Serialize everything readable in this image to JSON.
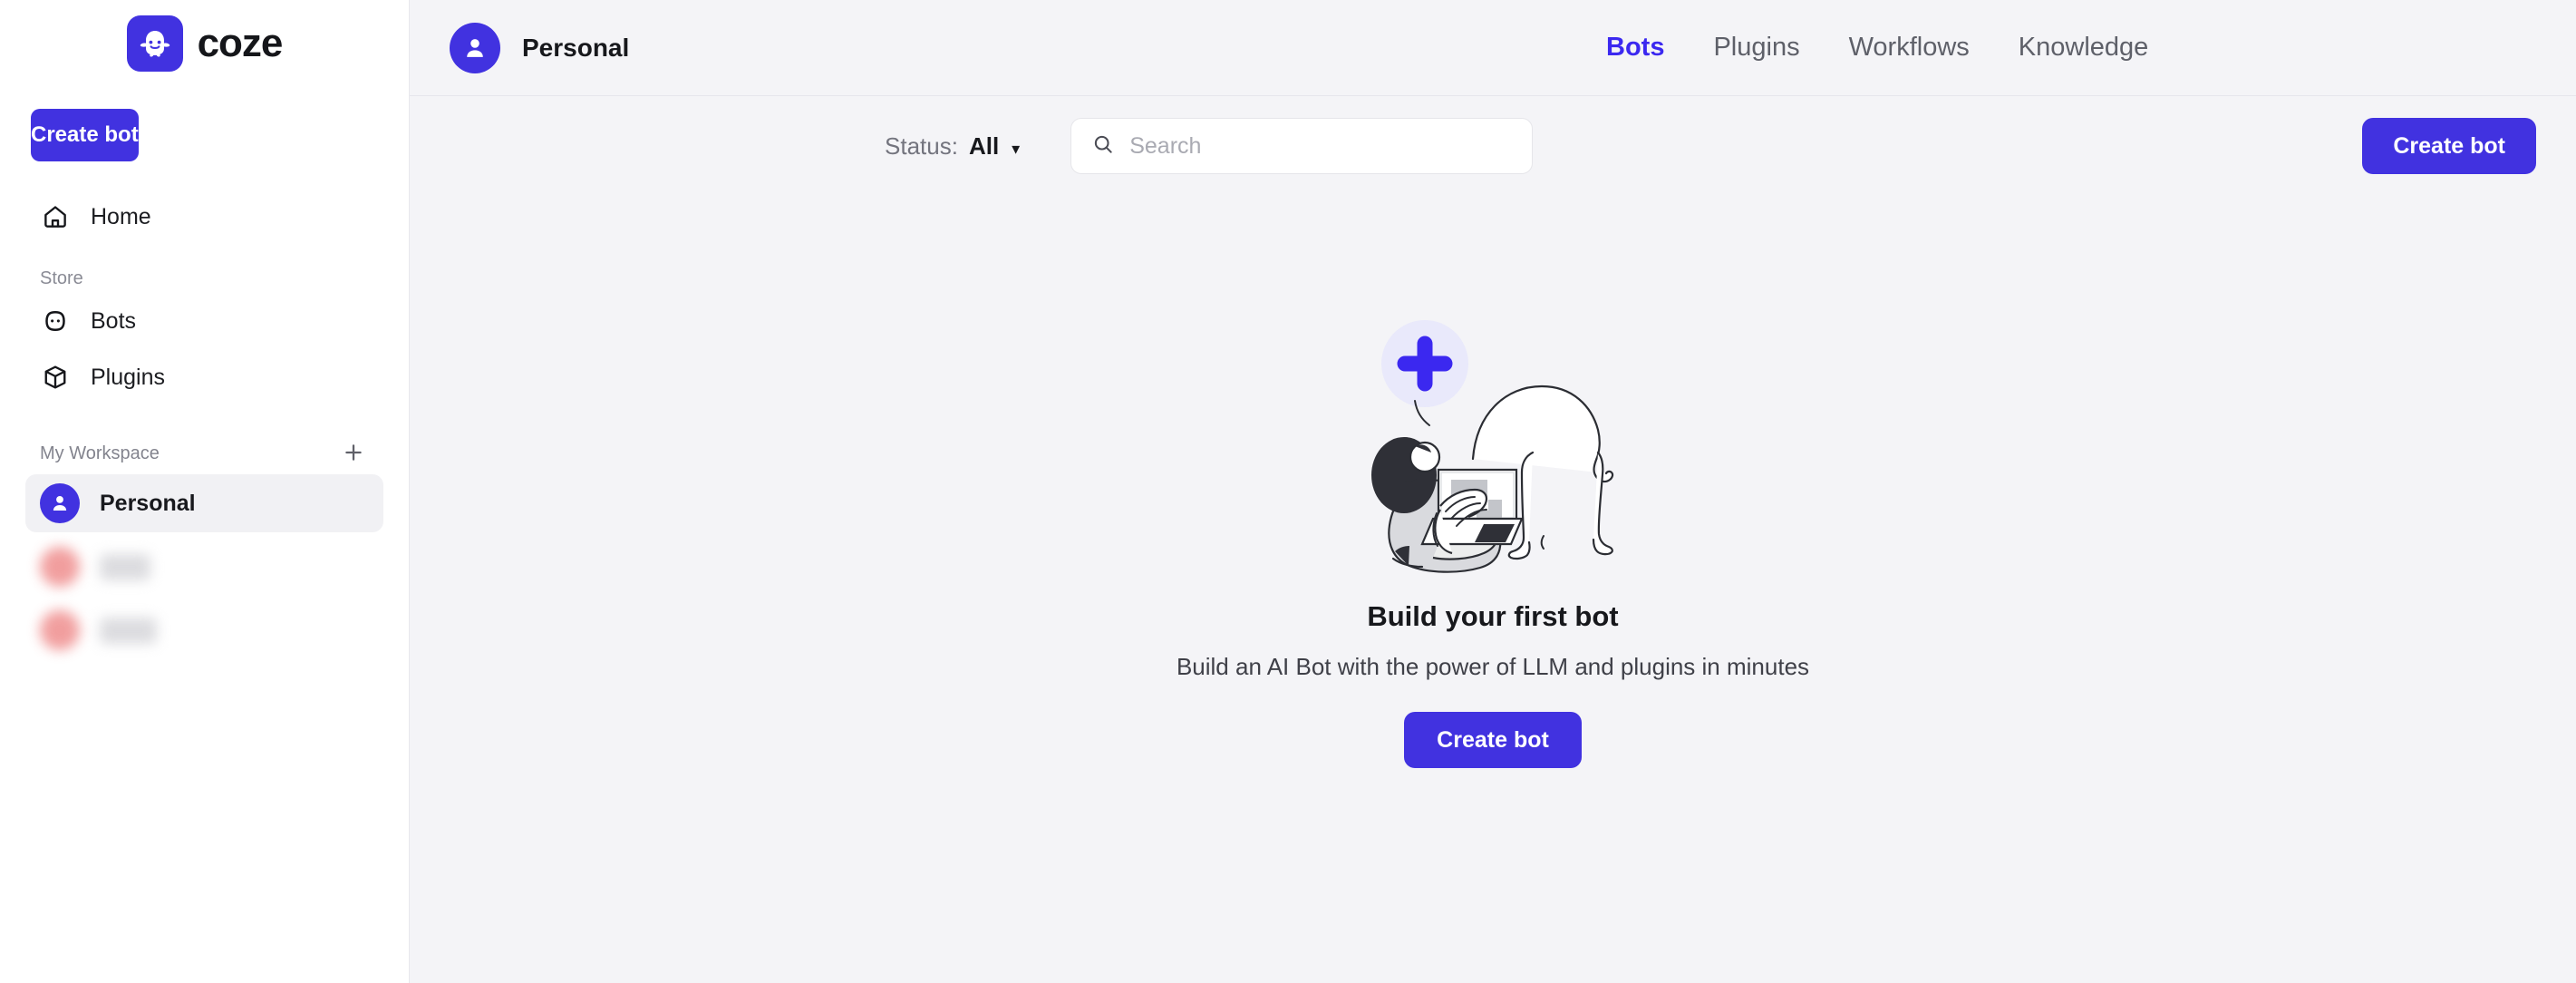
{
  "brand": {
    "name": "coze",
    "logo_icon": "coze-ghost-icon",
    "accent_color": "#4132e0"
  },
  "sidebar": {
    "create_bot_label": "Create bot",
    "primary_nav": [
      {
        "label": "Home",
        "icon": "home-icon"
      }
    ],
    "store_section": {
      "title": "Store",
      "items": [
        {
          "label": "Bots",
          "icon": "robot-face-icon"
        },
        {
          "label": "Plugins",
          "icon": "cube-icon"
        }
      ]
    },
    "workspace_section": {
      "title": "My Workspace",
      "add_icon": "plus-icon",
      "items": [
        {
          "label": "Personal",
          "icon": "person-avatar-icon",
          "active": true,
          "redacted": false
        },
        {
          "label": "",
          "icon": "person-avatar-icon",
          "active": false,
          "redacted": true
        },
        {
          "label": "",
          "icon": "person-avatar-icon",
          "active": false,
          "redacted": true
        }
      ]
    }
  },
  "header": {
    "space_name": "Personal",
    "space_icon": "person-avatar-icon",
    "tabs": [
      {
        "label": "Bots",
        "active": true
      },
      {
        "label": "Plugins",
        "active": false
      },
      {
        "label": "Workflows",
        "active": false
      },
      {
        "label": "Knowledge",
        "active": false
      }
    ]
  },
  "toolbar": {
    "status_label": "Status:",
    "status_value": "All",
    "status_caret_icon": "chevron-down-icon",
    "search_icon": "search-icon",
    "search_value": "",
    "search_placeholder": "Search",
    "create_bot_label": "Create bot"
  },
  "empty_state": {
    "illustration": "person-with-laptop-and-cat-illustration",
    "plus_badge_icon": "plus-icon",
    "title": "Build your first bot",
    "subtitle": "Build an AI Bot with the power of LLM and plugins in minutes",
    "cta_label": "Create bot"
  }
}
